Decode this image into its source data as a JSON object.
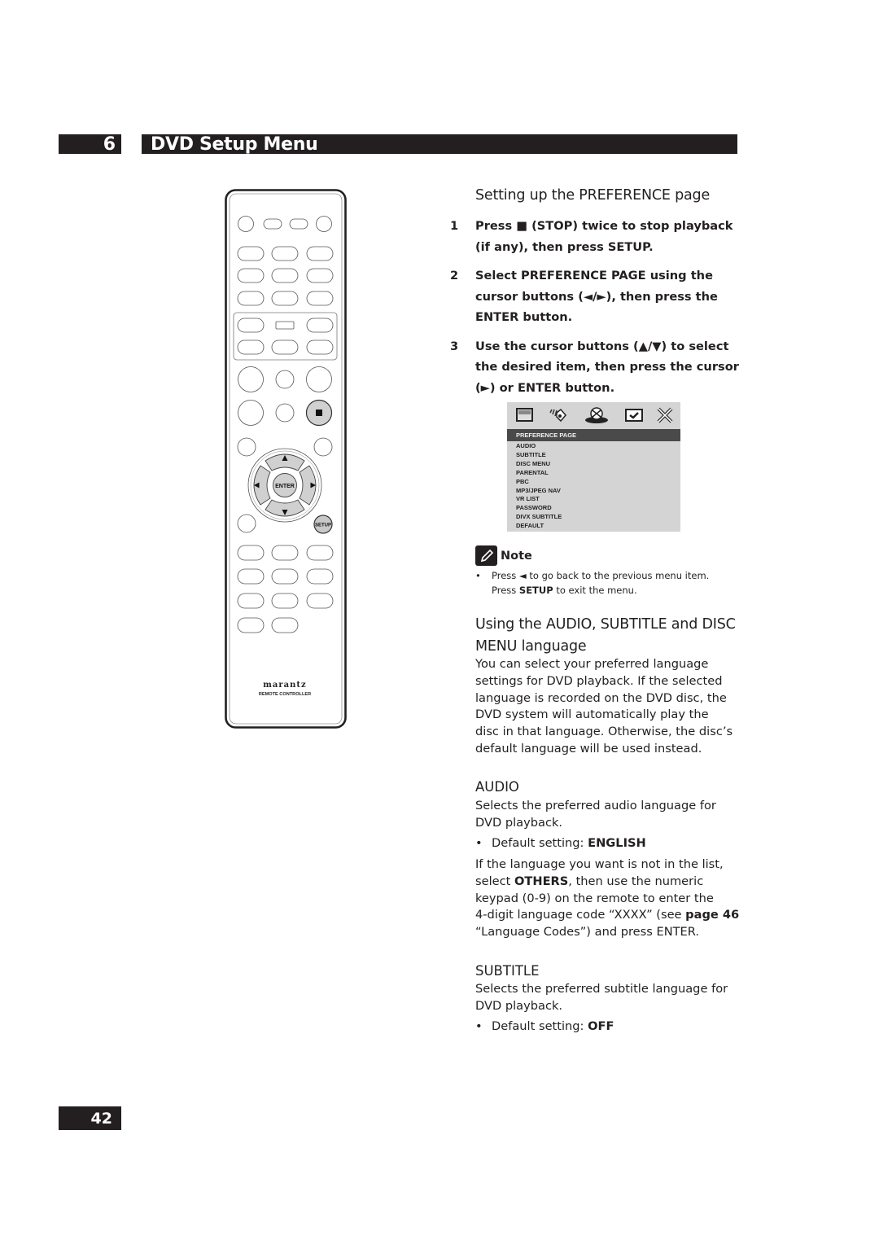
{
  "header": {
    "chapter_number": "6",
    "chapter_title": "DVD Setup Menu"
  },
  "remote": {
    "brand": "marantz",
    "subtitle": "REMOTE CONTROLLER",
    "enter_label": "ENTER",
    "setup_label": "SETUP",
    "stop_icon": "stop-square-icon"
  },
  "preference": {
    "title": "Setting up the PREFERENCE page",
    "steps": [
      {
        "num": "1",
        "text": "Press ■ (STOP) twice to stop playback (if any), then press SETUP."
      },
      {
        "num": "2",
        "text": "Select PREFERENCE PAGE using the cursor buttons (◄/►), then press the ENTER button."
      },
      {
        "num": "3",
        "text": "Use the cursor buttons (▲/▼) to select the desired item, then press the cursor (►) or ENTER button."
      }
    ]
  },
  "osd": {
    "icons": [
      "general-setup-icon",
      "audio-setup-icon",
      "preference-disc-icon",
      "password-check-icon",
      "exit-x-icon"
    ],
    "page_title": "PREFERENCE PAGE",
    "items": [
      "AUDIO",
      "SUBTITLE",
      "DISC MENU",
      "PARENTAL",
      "PBC",
      "MP3/JPEG NAV",
      "VR LIST",
      "PASSWORD",
      "DIVX SUBTITLE",
      "DEFAULT"
    ]
  },
  "note": {
    "label": "Note",
    "bullet": "•",
    "line1_prefix": "Press ◄ to go back to the previous menu item.",
    "line2_a": "Press ",
    "line2_bold": "SETUP",
    "line2_b": " to exit the menu."
  },
  "language": {
    "title_line1": "Using the AUDIO, SUBTITLE and DISC",
    "title_line2": "MENU language",
    "paragraph": [
      "You can select your preferred language",
      "settings for DVD playback. If the selected",
      "language is recorded on the DVD disc, the",
      "DVD system will automatically play the",
      "disc in that language. Otherwise, the disc’s",
      "default language will be used instead."
    ]
  },
  "audio": {
    "heading": "AUDIO",
    "desc": [
      "Selects the preferred audio language for",
      "DVD playback."
    ],
    "default_label": "Default setting: ",
    "default_value": "ENGLISH",
    "others_p1": "If the language you want is not in the list,",
    "others_p2a": "select ",
    "others_p2bold": "OTHERS",
    "others_p2b": ", then use the numeric",
    "others_p3": "keypad (0-9) on the remote to enter the",
    "others_p4a": "4-digit language code “XXXX” (see ",
    "others_p4bold": "page 46",
    "others_p5": "“Language Codes”) and press ENTER."
  },
  "subtitle": {
    "heading": "SUBTITLE",
    "desc": [
      "Selects the preferred subtitle language for",
      "DVD playback."
    ],
    "default_label": "Default setting: ",
    "default_value": "OFF"
  },
  "footer": {
    "page_number": "42"
  }
}
